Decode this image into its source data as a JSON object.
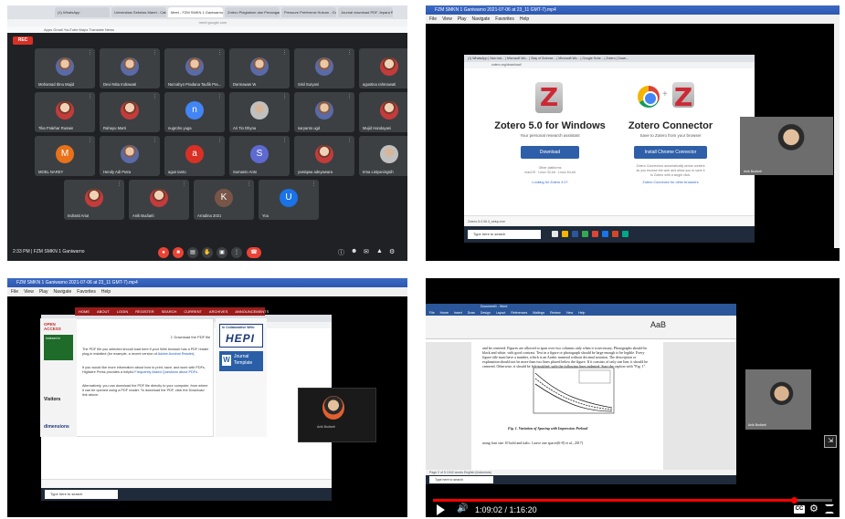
{
  "meet": {
    "rec_label": "REC",
    "url": "meet.google.com",
    "tabs": [
      "(1) WhatsApp",
      "Universitas Sebelas Maret - Cabang...",
      "Meet - FZM SMKN 1 Ganiwarno",
      "Zotero Plagiarism dan Penanganan - Shared...",
      "Pressure Preferensi Hukum - Google For...",
      "Journal download PDF Jepara Rasa..."
    ],
    "bookmarks": "Apps   Gmail   YouTube   Maps   Translate   News",
    "participants": [
      {
        "name": "Mohamad Ibnu Majid",
        "avatar": "photo"
      },
      {
        "name": "Devi Nitia Indrawati",
        "avatar": "photo"
      },
      {
        "name": "Nurcahyo Pradana Taufik Pra...",
        "avatar": "photo"
      },
      {
        "name": "Darmawan W",
        "avatar": "photo"
      },
      {
        "name": "Sisil Suryani",
        "avatar": "photo"
      },
      {
        "name": "agustina rahmawati",
        "avatar": "photo2"
      },
      {
        "name": "Tika Prakhar Ruswie",
        "avatar": "photo2"
      },
      {
        "name": "Rahayu Marti",
        "avatar": "photo2"
      },
      {
        "name": "nugroho yuga",
        "avatar": "n",
        "color": "#4285f4"
      },
      {
        "name": "Ari Tio Dhyna",
        "avatar": "photo3"
      },
      {
        "name": "saryanto ugd",
        "avatar": "photo"
      },
      {
        "name": "Mujid Handayani",
        "avatar": "photo2"
      },
      {
        "name": "MOEL NAREY",
        "avatar": "M",
        "color": "#e8711a"
      },
      {
        "name": "Hendy Adi Putra",
        "avatar": "photo"
      },
      {
        "name": "agus tanto",
        "avatar": "a",
        "color": "#d93025"
      },
      {
        "name": "Sumanto Anto",
        "avatar": "S",
        "color": "#5e6ad2"
      },
      {
        "name": "yustiqwa adeyawara",
        "avatar": "photo2"
      },
      {
        "name": "Irma Listyaningsih",
        "avatar": "photo3"
      },
      {
        "name": "Indrasti Ariut",
        "avatar": "photo2"
      },
      {
        "name": "Anik Budiarti",
        "avatar": "photo2"
      },
      {
        "name": "Arradina 2021",
        "avatar": "K",
        "color": "#795548"
      },
      {
        "name": "You",
        "avatar": "U",
        "color": "#1a73e8"
      }
    ],
    "meeting_time": "2:33 PM | FZM SMKN 1 Ganiwarno"
  },
  "zotero_video": {
    "window_title": "FZM SMKN 1 Ganiwarno 2021-07-06 at 23_11 GMT-7).mp4",
    "menu": [
      "File",
      "View",
      "Play",
      "Navigate",
      "Favorites",
      "Help"
    ],
    "browser_tabs": "(1) WhatsApp | Nan moi... | Microsoft Wo... | Stay of Science... | Microsoft Wo... | Google Sche... | Zotero | Down...",
    "url": "zotero.org/download/",
    "left_title": "Zotero 5.0 for Windows",
    "left_subtitle": "Your personal research assistant",
    "left_button": "Download",
    "left_other": "Other platforms\nmacOS · Linux 32-bit · Linux 64-bit",
    "left_link": "Looking for Zotero 4.0?",
    "right_title": "Zotero Connector",
    "right_subtitle": "Save to Zotero from your browser",
    "right_button": "Install Chrome Connector",
    "right_desc": "Zotero Connectors automatically sense content\nas you browse the web and allow you to save it\nto Zotero with a single click.",
    "right_link": "Zotero Connector for other browsers",
    "download_bar": "Zotero-5.0.96.3_setup.exe",
    "taskbar_search": "Type here to search",
    "cam_name": "Anik Budiarti"
  },
  "journal_video": {
    "window_title": "FZM SMKN 1 Ganiwarno 2021-07-06 at 23_11 GMT-7).mp4",
    "menu": [
      "File",
      "View",
      "Play",
      "Navigate",
      "Favorites",
      "Help"
    ],
    "nav_items": [
      "HOME",
      "ABOUT",
      "LOGIN",
      "REGISTER",
      "SEARCH",
      "CURRENT",
      "ARCHIVES",
      "ANNOUNCEMENTS"
    ],
    "journal_logo": "OPEN ACCESS",
    "indexed_label": "Indexed in",
    "download_pdf": "Download the PDF file",
    "para1_a": "The PDF file you selected should load here if your Web browser has a PDF reader plug-in installed (for example, a recent version of ",
    "para1_link": "Adobe Acrobat Reader",
    "para1_b": ").",
    "para2_a": "If you would like more information about how to print, save, and work with PDFs, Highwire Press provides a helpful ",
    "para2_link": "Frequently Asked Questions about PDFs",
    "para2_b": ".",
    "para3": "Alternatively, you can download the PDF file directly to your computer, from where it can be opened using a PDF reader. To download the PDF, click the Download link above.",
    "collab_label": "In Collaborative With:",
    "hepi_logo": "HEPI",
    "template_label": "Journal Template",
    "visitors_label": "Visitors",
    "dimensions_label": "dimensions",
    "cam_name": "Anik Budiarti"
  },
  "word_video": {
    "window_title": "Document1 - Word",
    "ribbon_tabs": [
      "File",
      "Home",
      "Insert",
      "Draw",
      "Design",
      "Layout",
      "References",
      "Mailings",
      "Review",
      "View",
      "Help"
    ],
    "styles_sample": "AaB",
    "body_text": "and be centered. Figures are allowed to span over two columns only when it is necessary. Photographs should be black and white, with good contrast. Text in a figure or photograph should be large enough to be legible. Every figure title must have a number, which is an Arabic numeral without decimal notation. The description or explanation should not be more than two lines placed below the figure. If it consists of only one line, it should be centered. Otherwise, it should be left-justified, with the following lines indented. Start the caption with \"Fig. 1\".",
    "figure_caption": "Fig. 1. Variation of Spacing with Impression Preload",
    "body_text2": "using font size 10 bold and italic. Leave one spacer[6-8] et al., 2017)",
    "status_text": "Page 2 of 5   1042 words   English (Indonesia)",
    "taskbar_search": "Type here to search",
    "cam_name": "Anik Budiarti",
    "player": {
      "current_time": "1:09:02",
      "total_time": "1:16:20",
      "progress": 0.904
    }
  }
}
